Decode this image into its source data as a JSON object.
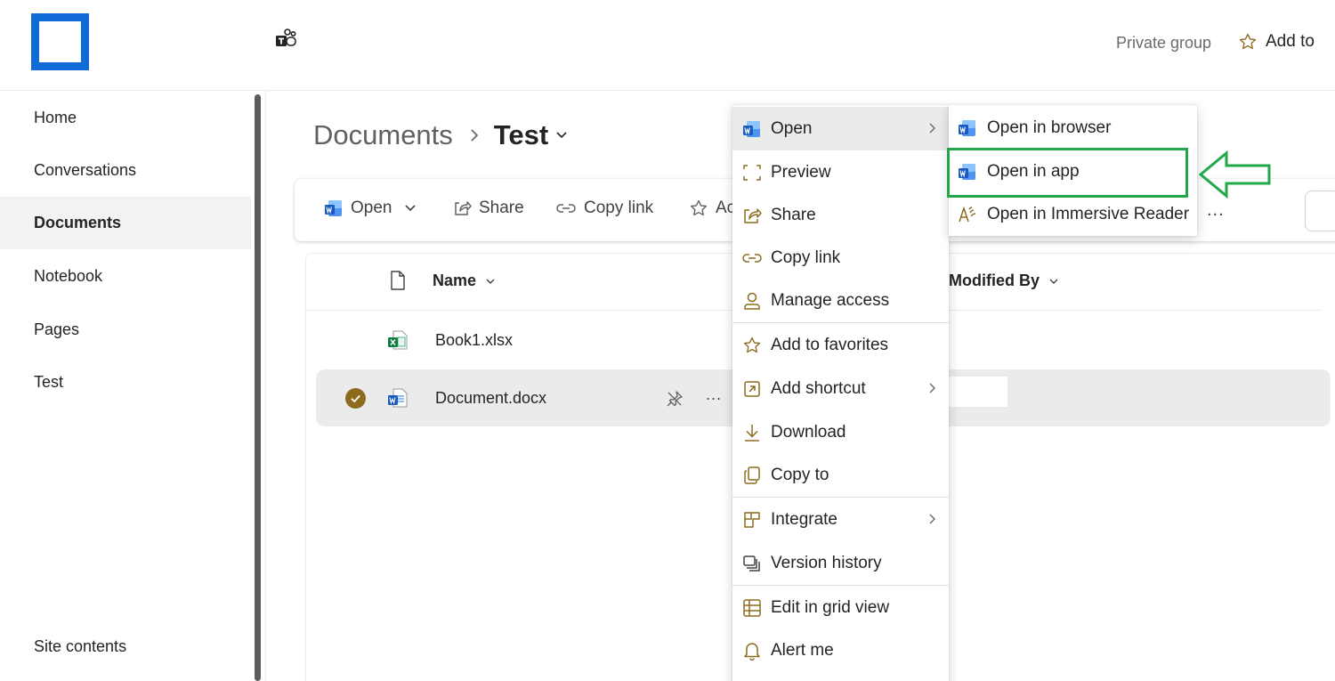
{
  "header": {
    "private_group": "Private group",
    "add_to": "Add to",
    "logo_color": "#0f6cd6"
  },
  "sidebar": {
    "items": [
      {
        "label": "Home"
      },
      {
        "label": "Conversations"
      },
      {
        "label": "Documents",
        "active": true
      },
      {
        "label": "Notebook"
      },
      {
        "label": "Pages"
      },
      {
        "label": "Test"
      }
    ],
    "bottom_item": {
      "label": "Site contents"
    }
  },
  "breadcrumb": {
    "root": "Documents",
    "current": "Test"
  },
  "commandbar": {
    "open": "Open",
    "share": "Share",
    "copy_link": "Copy link",
    "add_partial": "Ac",
    "more": "..."
  },
  "list": {
    "columns": {
      "name": "Name",
      "modified_by": "Modified By"
    },
    "rows": [
      {
        "name": "Book1.xlsx",
        "icon": "excel-file-icon",
        "selected": false
      },
      {
        "name": "Document.docx",
        "icon": "word-file-icon",
        "selected": true
      }
    ],
    "row_more": "..."
  },
  "context_menu": {
    "items": [
      {
        "label": "Open",
        "icon": "word-app-icon",
        "submenu": true,
        "hover": true
      },
      {
        "label": "Preview",
        "icon": "preview-icon"
      },
      {
        "label": "Share",
        "icon": "share-icon"
      },
      {
        "label": "Copy link",
        "icon": "link-icon"
      },
      {
        "label": "Manage access",
        "icon": "person-icon"
      },
      {
        "label": "Add to favorites",
        "icon": "star-icon"
      },
      {
        "label": "Add shortcut",
        "icon": "shortcut-icon",
        "submenu": true
      },
      {
        "label": "Download",
        "icon": "download-icon"
      },
      {
        "label": "Copy to",
        "icon": "copy-icon"
      },
      {
        "label": "Integrate",
        "icon": "integrate-icon",
        "submenu": true
      },
      {
        "label": "Version history",
        "icon": "version-history-icon"
      },
      {
        "label": "Edit in grid view",
        "icon": "grid-icon"
      },
      {
        "label": "Alert me",
        "icon": "bell-icon"
      }
    ]
  },
  "open_submenu": {
    "items": [
      {
        "label": "Open in browser",
        "icon": "word-app-icon"
      },
      {
        "label": "Open in app",
        "icon": "word-app-icon",
        "highlighted": true
      },
      {
        "label": "Open in Immersive Reader",
        "icon": "immersive-reader-icon"
      }
    ]
  },
  "colors": {
    "accent_icon": "#8c6b1e",
    "highlight_green": "#22a84a",
    "word_blue": "#185abd"
  }
}
